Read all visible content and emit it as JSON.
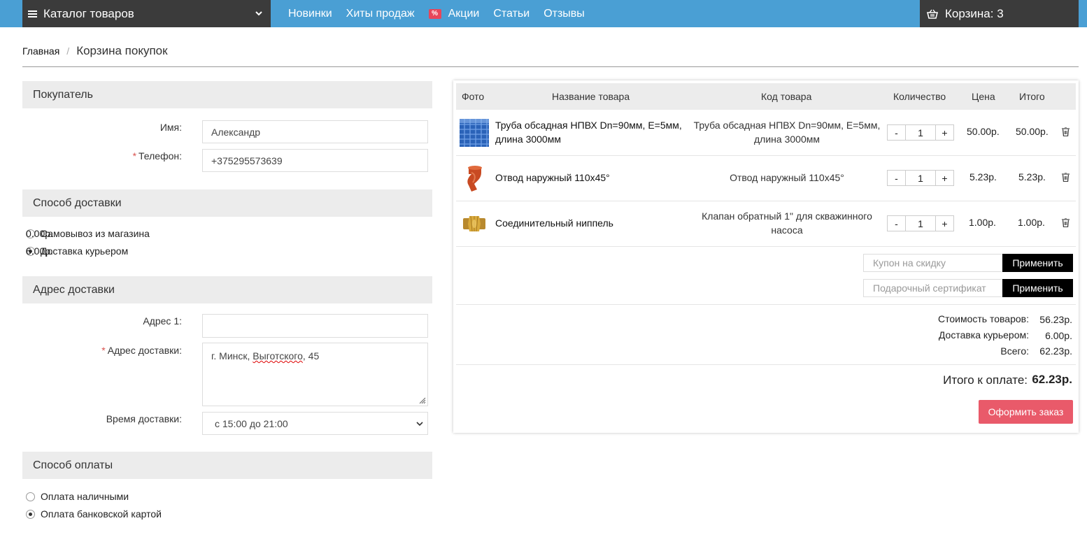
{
  "topbar": {
    "catalog_label": "Каталог товаров",
    "nav": [
      "Новинки",
      "Хиты продаж",
      "Акции",
      "Статьи",
      "Отзывы"
    ],
    "promo_badge": "%",
    "cart_label": "Корзина: 3"
  },
  "breadcrumb": {
    "home": "Главная",
    "separator": "/",
    "current": "Корзина покупок"
  },
  "buyer": {
    "title": "Покупатель",
    "name_label": "Имя:",
    "name_value": "Александр",
    "phone_required": "*",
    "phone_label": "Телефон:",
    "phone_value": "+375295573639"
  },
  "delivery": {
    "title": "Способ доставки",
    "options": [
      {
        "label": "Самовывоз из магазина",
        "price": "0.00р.",
        "selected": false
      },
      {
        "label": "Доставка курьером",
        "price": "6.00р.",
        "selected": true
      }
    ]
  },
  "address": {
    "title": "Адрес доставки",
    "addr1_label": "Адрес 1:",
    "addr1_value": "",
    "addr_required": "*",
    "addr_label": "Адрес доставки:",
    "addr_value_prefix": "г. Минск, ",
    "addr_value_street": "Выготского",
    "addr_value_suffix": ", 45",
    "time_label": "Время доставки:",
    "time_value": "с 15:00 до 21:00"
  },
  "payment": {
    "title": "Способ оплаты",
    "options": [
      {
        "label": "Оплата наличными",
        "selected": false
      },
      {
        "label": "Оплата банковской картой",
        "selected": true
      }
    ]
  },
  "cart_table": {
    "headers": [
      "Фото",
      "Название товара",
      "Код товара",
      "Количество",
      "Цена",
      "Итого"
    ],
    "rows": [
      {
        "name": "Труба обсадная НПВХ Dn=90мм, E=5мм, длина 3000мм",
        "code": "Труба обсадная НПВХ Dn=90мм, E=5мм, длина 3000мм",
        "qty": "1",
        "price": "50.00р.",
        "total": "50.00р.",
        "image": "blue-pipe"
      },
      {
        "name": "Отвод наружный 110x45°",
        "code": "Отвод наружный 110x45°",
        "qty": "1",
        "price": "5.23р.",
        "total": "5.23р.",
        "image": "orange-elbow"
      },
      {
        "name": "Соединительный ниппель",
        "code": "Клапан обратный 1\" для скважинного насоса",
        "qty": "1",
        "price": "1.00р.",
        "total": "1.00р.",
        "image": "brass-nipple"
      }
    ],
    "minus": "-",
    "plus": "+"
  },
  "coupons": {
    "coupon_placeholder": "Купон на скидку",
    "gift_placeholder": "Подарочный сертификат",
    "apply_label": "Применить"
  },
  "summary": {
    "goods_label": "Стоимость товаров:",
    "goods_value": "56.23р.",
    "delivery_label": "Доставка курьером:",
    "delivery_value": "6.00р.",
    "total_label": "Всего:",
    "total_value": "62.23р.",
    "pay_label": "Итого к оплате:",
    "pay_value": "62.23р.",
    "checkout_label": "Оформить заказ"
  },
  "colors": {
    "topbar": "#4a9fd4",
    "dark": "#3b3b3b",
    "accent": "#e95a6a",
    "section": "#ececec"
  }
}
